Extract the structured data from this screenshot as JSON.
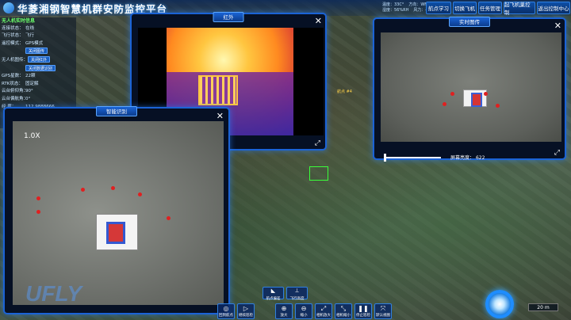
{
  "app": {
    "title": "华菱湘钢智慧机群安防监控平台"
  },
  "weather": {
    "temp": "温度：33C°",
    "direction": "方向：WNW",
    "humidity": "湿度：56%RH",
    "wind_force": "风力：4级"
  },
  "topnav": {
    "items": [
      "航点学习",
      "切换飞机",
      "任务管理",
      "起飞机巢控制",
      "返出控制中心"
    ]
  },
  "uav_info": {
    "title": "无人机实时信息",
    "rows": [
      {
        "k": "连接状态：",
        "v": "在线"
      },
      {
        "k": "飞行状态：",
        "v": "飞行"
      },
      {
        "k": "遥控模式：",
        "v": "GPS模式"
      }
    ],
    "btn_close_video": "关闭图传",
    "camera_label": "无人机图传：",
    "btn_close_ir": "关闭红外",
    "btn_close_bright": "关闭数据识别",
    "rows2": [
      {
        "k": "GPS星数：",
        "v": "22颗"
      },
      {
        "k": "RTK状态：",
        "v": "固定解"
      },
      {
        "k": "云台俯仰角：",
        "v": "90°"
      },
      {
        "k": "云台偏航角：",
        "v": "0°"
      },
      {
        "k": "经    度：",
        "v": "112.9888666"
      }
    ]
  },
  "windows": {
    "thermal": {
      "title": "红外"
    },
    "realtime": {
      "title": "实时图传",
      "brightness_label": "屏幕亮度：",
      "brightness_value": "622"
    },
    "smart": {
      "title": "智能识别",
      "zoom": "1.0X"
    }
  },
  "map": {
    "waypoint": "航点 #4",
    "scale": "20 m",
    "watermark": "UFLY"
  },
  "toolbar": {
    "top": [
      {
        "label": "航点偏差"
      },
      {
        "label": "飞行高度"
      }
    ],
    "buttons": [
      {
        "icon": "target-icon",
        "glyph": "◎",
        "label": "回到航点"
      },
      {
        "icon": "play-icon",
        "glyph": "▷",
        "label": "继续巡检"
      },
      {
        "icon": "zoom-in-icon",
        "glyph": "⊕",
        "label": "放大"
      },
      {
        "icon": "zoom-out-icon",
        "glyph": "⊖",
        "label": "缩小"
      },
      {
        "icon": "expand-icon",
        "glyph": "⤢",
        "label": "相机放大"
      },
      {
        "icon": "shrink-icon",
        "glyph": "⤡",
        "label": "相机缩小"
      },
      {
        "icon": "pause-icon",
        "glyph": "❚❚",
        "label": "停止巡检"
      },
      {
        "icon": "reset-icon",
        "glyph": "⤧",
        "label": "默认视图"
      }
    ]
  }
}
